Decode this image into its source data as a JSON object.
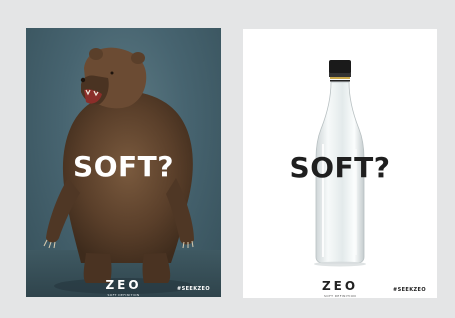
{
  "colors": {
    "background": "#e4e5e6",
    "left_poster_bg": "#476470",
    "right_poster_bg": "#ffffff",
    "bear_fur": "#5a3f2a",
    "bottle_cap": "#1a1a1a"
  },
  "left_poster": {
    "headline": "SOFT?",
    "brand": "ZEO",
    "brand_tagline": "SOFT DEFINITION",
    "hashtag": "#SEEKZEO",
    "image": "grizzly-bear-roaring"
  },
  "right_poster": {
    "headline": "SOFT?",
    "brand": "ZEO",
    "brand_tagline": "SOFT DEFINITION",
    "hashtag": "#SEEKZEO",
    "image": "clear-glass-bottle"
  }
}
